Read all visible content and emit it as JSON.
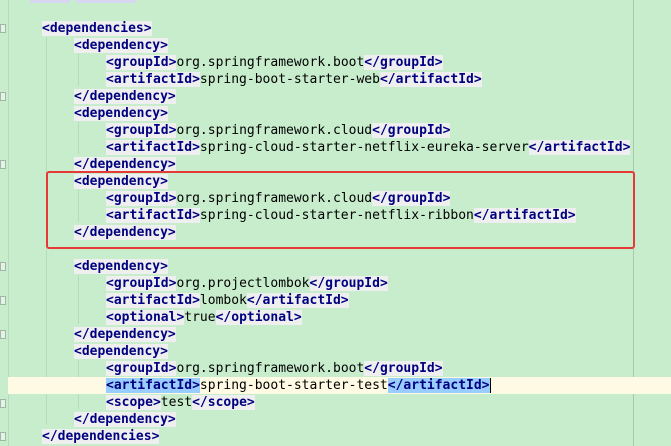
{
  "editor": {
    "lines": [
      {
        "indent": 0,
        "parts": [
          {
            "t": "tag",
            "v": "<dependencies>"
          }
        ]
      },
      {
        "indent": 1,
        "parts": [
          {
            "t": "tag",
            "v": "<dependency>"
          }
        ]
      },
      {
        "indent": 2,
        "parts": [
          {
            "t": "tag",
            "v": "<groupId>"
          },
          {
            "t": "txt",
            "v": "org.springframework.boot"
          },
          {
            "t": "tag",
            "v": "</groupId>"
          }
        ]
      },
      {
        "indent": 2,
        "parts": [
          {
            "t": "tag",
            "v": "<artifactId>"
          },
          {
            "t": "txt",
            "v": "spring-boot-starter-web"
          },
          {
            "t": "tag",
            "v": "</artifactId>"
          }
        ]
      },
      {
        "indent": 1,
        "parts": [
          {
            "t": "tag",
            "v": "</dependency>"
          }
        ]
      },
      {
        "indent": 1,
        "parts": [
          {
            "t": "tag",
            "v": "<dependency>"
          }
        ]
      },
      {
        "indent": 2,
        "parts": [
          {
            "t": "tag",
            "v": "<groupId>"
          },
          {
            "t": "txt",
            "v": "org.springframework.cloud"
          },
          {
            "t": "tag",
            "v": "</groupId>"
          }
        ]
      },
      {
        "indent": 2,
        "parts": [
          {
            "t": "tag",
            "v": "<artifactId>"
          },
          {
            "t": "txt",
            "v": "spring-cloud-starter-netflix-eureka-server"
          },
          {
            "t": "tag",
            "v": "</artifactId>"
          }
        ]
      },
      {
        "indent": 1,
        "parts": [
          {
            "t": "tag",
            "v": "</dependency>"
          }
        ]
      },
      {
        "indent": 1,
        "parts": [
          {
            "t": "tag",
            "v": "<dependency>"
          }
        ]
      },
      {
        "indent": 2,
        "parts": [
          {
            "t": "tag",
            "v": "<groupId>"
          },
          {
            "t": "txt",
            "v": "org.springframework.cloud"
          },
          {
            "t": "tag",
            "v": "</groupId>"
          }
        ]
      },
      {
        "indent": 2,
        "parts": [
          {
            "t": "tag",
            "v": "<artifactId>"
          },
          {
            "t": "txt",
            "v": "spring-cloud-starter-netflix-ribbon"
          },
          {
            "t": "tag",
            "v": "</artifactId>"
          }
        ]
      },
      {
        "indent": 1,
        "parts": [
          {
            "t": "tag",
            "v": "</dependency>"
          }
        ]
      },
      {
        "indent": 0,
        "parts": []
      },
      {
        "indent": 1,
        "parts": [
          {
            "t": "tag",
            "v": "<dependency>"
          }
        ]
      },
      {
        "indent": 2,
        "parts": [
          {
            "t": "tag",
            "v": "<groupId>"
          },
          {
            "t": "txt",
            "v": "org.projectlombok"
          },
          {
            "t": "tag",
            "v": "</groupId>"
          }
        ]
      },
      {
        "indent": 2,
        "parts": [
          {
            "t": "tag",
            "v": "<artifactId>"
          },
          {
            "t": "txt",
            "v": "lombok"
          },
          {
            "t": "tag",
            "v": "</artifactId>"
          }
        ]
      },
      {
        "indent": 2,
        "parts": [
          {
            "t": "tag",
            "v": "<optional>"
          },
          {
            "t": "txt",
            "v": "true"
          },
          {
            "t": "tag",
            "v": "</optional>"
          }
        ]
      },
      {
        "indent": 1,
        "parts": [
          {
            "t": "tag",
            "v": "</dependency>"
          }
        ]
      },
      {
        "indent": 1,
        "parts": [
          {
            "t": "tag",
            "v": "<dependency>"
          }
        ]
      },
      {
        "indent": 2,
        "parts": [
          {
            "t": "tag",
            "v": "<groupId>"
          },
          {
            "t": "txt",
            "v": "org.springframework.boot"
          },
          {
            "t": "tag",
            "v": "</groupId>"
          }
        ]
      },
      {
        "indent": 2,
        "current": true,
        "parts": [
          {
            "t": "tag",
            "v": "<artifactId>",
            "match": true
          },
          {
            "t": "txt",
            "v": "spring-boot-starter-test"
          },
          {
            "t": "tag",
            "v": "</artifactId>",
            "match": true
          }
        ]
      },
      {
        "indent": 2,
        "parts": [
          {
            "t": "tag",
            "v": "<scope>"
          },
          {
            "t": "txt",
            "v": "test"
          },
          {
            "t": "tag",
            "v": "</scope>"
          }
        ]
      },
      {
        "indent": 1,
        "parts": [
          {
            "t": "tag",
            "v": "</dependency>"
          }
        ]
      },
      {
        "indent": 0,
        "parts": [
          {
            "t": "tag",
            "v": "</dependencies>"
          }
        ]
      }
    ],
    "colors": {
      "background": "#c7edcc",
      "tag_text": "#000080",
      "tag_background": "#efefef",
      "matched_tag_background": "#99ccff",
      "current_line": "#fffae3",
      "annotation_box": "#e53935"
    }
  }
}
